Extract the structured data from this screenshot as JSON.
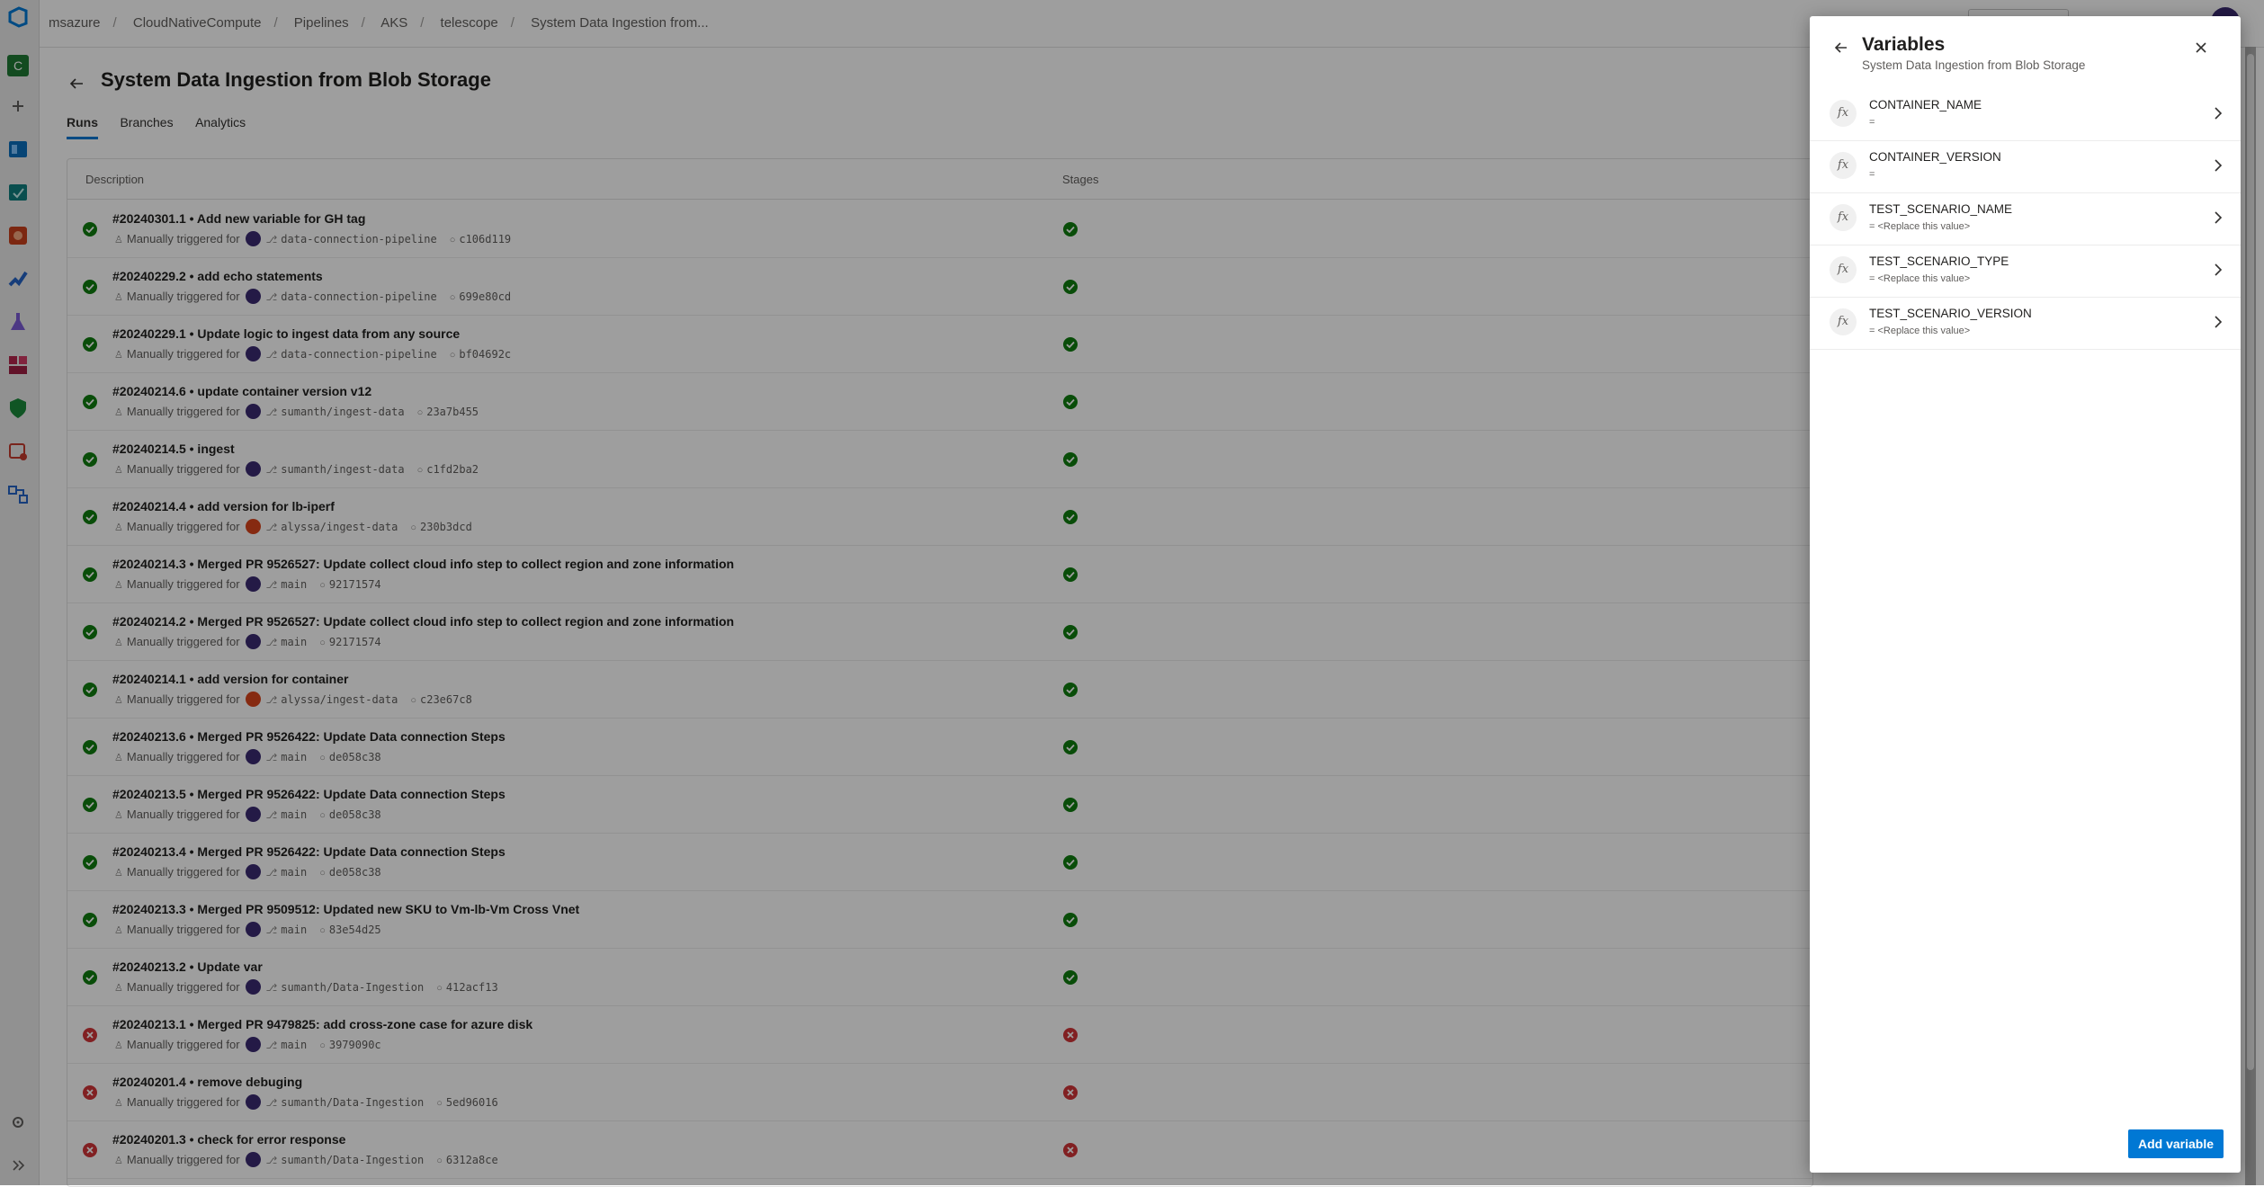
{
  "breadcrumb": [
    "msazure",
    "CloudNativeCompute",
    "Pipelines",
    "AKS",
    "telescope",
    "System Data Ingestion from..."
  ],
  "page": {
    "title": "System Data Ingestion from Blob Storage",
    "tabs": [
      "Runs",
      "Branches",
      "Analytics"
    ]
  },
  "table": {
    "col_description": "Description",
    "col_stages": "Stages",
    "trigger_text": "Manually triggered for",
    "runs": [
      {
        "title": "#20240301.1 • Add new variable for GH tag",
        "branch": "data-connection-pipeline",
        "commit": "c106d119",
        "status": "success",
        "avatar": "purple"
      },
      {
        "title": "#20240229.2 • add echo statements",
        "branch": "data-connection-pipeline",
        "commit": "699e80cd",
        "status": "success",
        "avatar": "purple"
      },
      {
        "title": "#20240229.1 • Update logic to ingest data from any source",
        "branch": "data-connection-pipeline",
        "commit": "bf04692c",
        "status": "success",
        "avatar": "purple"
      },
      {
        "title": "#20240214.6 • update container version v12",
        "branch": "sumanth/ingest-data",
        "commit": "23a7b455",
        "status": "success",
        "avatar": "purple"
      },
      {
        "title": "#20240214.5 • ingest",
        "branch": "sumanth/ingest-data",
        "commit": "c1fd2ba2",
        "status": "success",
        "avatar": "purple"
      },
      {
        "title": "#20240214.4 • add version for lb-iperf",
        "branch": "alyssa/ingest-data",
        "commit": "230b3dcd",
        "status": "success",
        "avatar": "orange"
      },
      {
        "title": "#20240214.3 • Merged PR 9526527: Update collect cloud info step to collect region and zone information",
        "branch": "main",
        "commit": "92171574",
        "status": "success",
        "avatar": "purple"
      },
      {
        "title": "#20240214.2 • Merged PR 9526527: Update collect cloud info step to collect region and zone information",
        "branch": "main",
        "commit": "92171574",
        "status": "success",
        "avatar": "purple"
      },
      {
        "title": "#20240214.1 • add version for container",
        "branch": "alyssa/ingest-data",
        "commit": "c23e67c8",
        "status": "success",
        "avatar": "orange"
      },
      {
        "title": "#20240213.6 • Merged PR 9526422: Update Data connection Steps",
        "branch": "main",
        "commit": "de058c38",
        "status": "success",
        "avatar": "purple"
      },
      {
        "title": "#20240213.5 • Merged PR 9526422: Update Data connection Steps",
        "branch": "main",
        "commit": "de058c38",
        "status": "success",
        "avatar": "purple"
      },
      {
        "title": "#20240213.4 • Merged PR 9526422: Update Data connection Steps",
        "branch": "main",
        "commit": "de058c38",
        "status": "success",
        "avatar": "purple"
      },
      {
        "title": "#20240213.3 • Merged PR 9509512: Updated new SKU to Vm-lb-Vm Cross Vnet",
        "branch": "main",
        "commit": "83e54d25",
        "status": "success",
        "avatar": "purple"
      },
      {
        "title": "#20240213.2 • Update var",
        "branch": "sumanth/Data-Ingestion",
        "commit": "412acf13",
        "status": "success",
        "avatar": "purple"
      },
      {
        "title": "#20240213.1 • Merged PR 9479825: add cross-zone case for azure disk",
        "branch": "main",
        "commit": "3979090c",
        "status": "failed",
        "avatar": "purple"
      },
      {
        "title": "#20240201.4 • remove debuging",
        "branch": "sumanth/Data-Ingestion",
        "commit": "5ed96016",
        "status": "failed",
        "avatar": "purple"
      },
      {
        "title": "#20240201.3 • check for error response",
        "branch": "sumanth/Data-Ingestion",
        "commit": "6312a8ce",
        "status": "failed",
        "avatar": "purple"
      }
    ]
  },
  "panel": {
    "title": "Variables",
    "subtitle": "System Data Ingestion from Blob Storage",
    "fx_label": "fx",
    "variables": [
      {
        "name": "CONTAINER_NAME",
        "value": "="
      },
      {
        "name": "CONTAINER_VERSION",
        "value": "="
      },
      {
        "name": "TEST_SCENARIO_NAME",
        "value": "= <Replace this value>"
      },
      {
        "name": "TEST_SCENARIO_TYPE",
        "value": "= <Replace this value>"
      },
      {
        "name": "TEST_SCENARIO_VERSION",
        "value": "= <Replace this value>"
      }
    ],
    "add_button": "Add variable"
  },
  "colors": {
    "accent": "#0078d4",
    "success": "#107c10",
    "failed": "#d13438",
    "overlay": "rgba(0,0,0,0.38)"
  },
  "icons": {
    "rail": [
      "azure-devops-logo-icon",
      "project-c-icon",
      "plus-icon",
      "boards-icon",
      "repos-icon",
      "artifacts-red-icon",
      "pipelines-icon",
      "test-plans-icon",
      "artifacts-icon",
      "security-icon",
      "release-icon",
      "integration-icon",
      "settings-icon",
      "expand-icon"
    ]
  }
}
